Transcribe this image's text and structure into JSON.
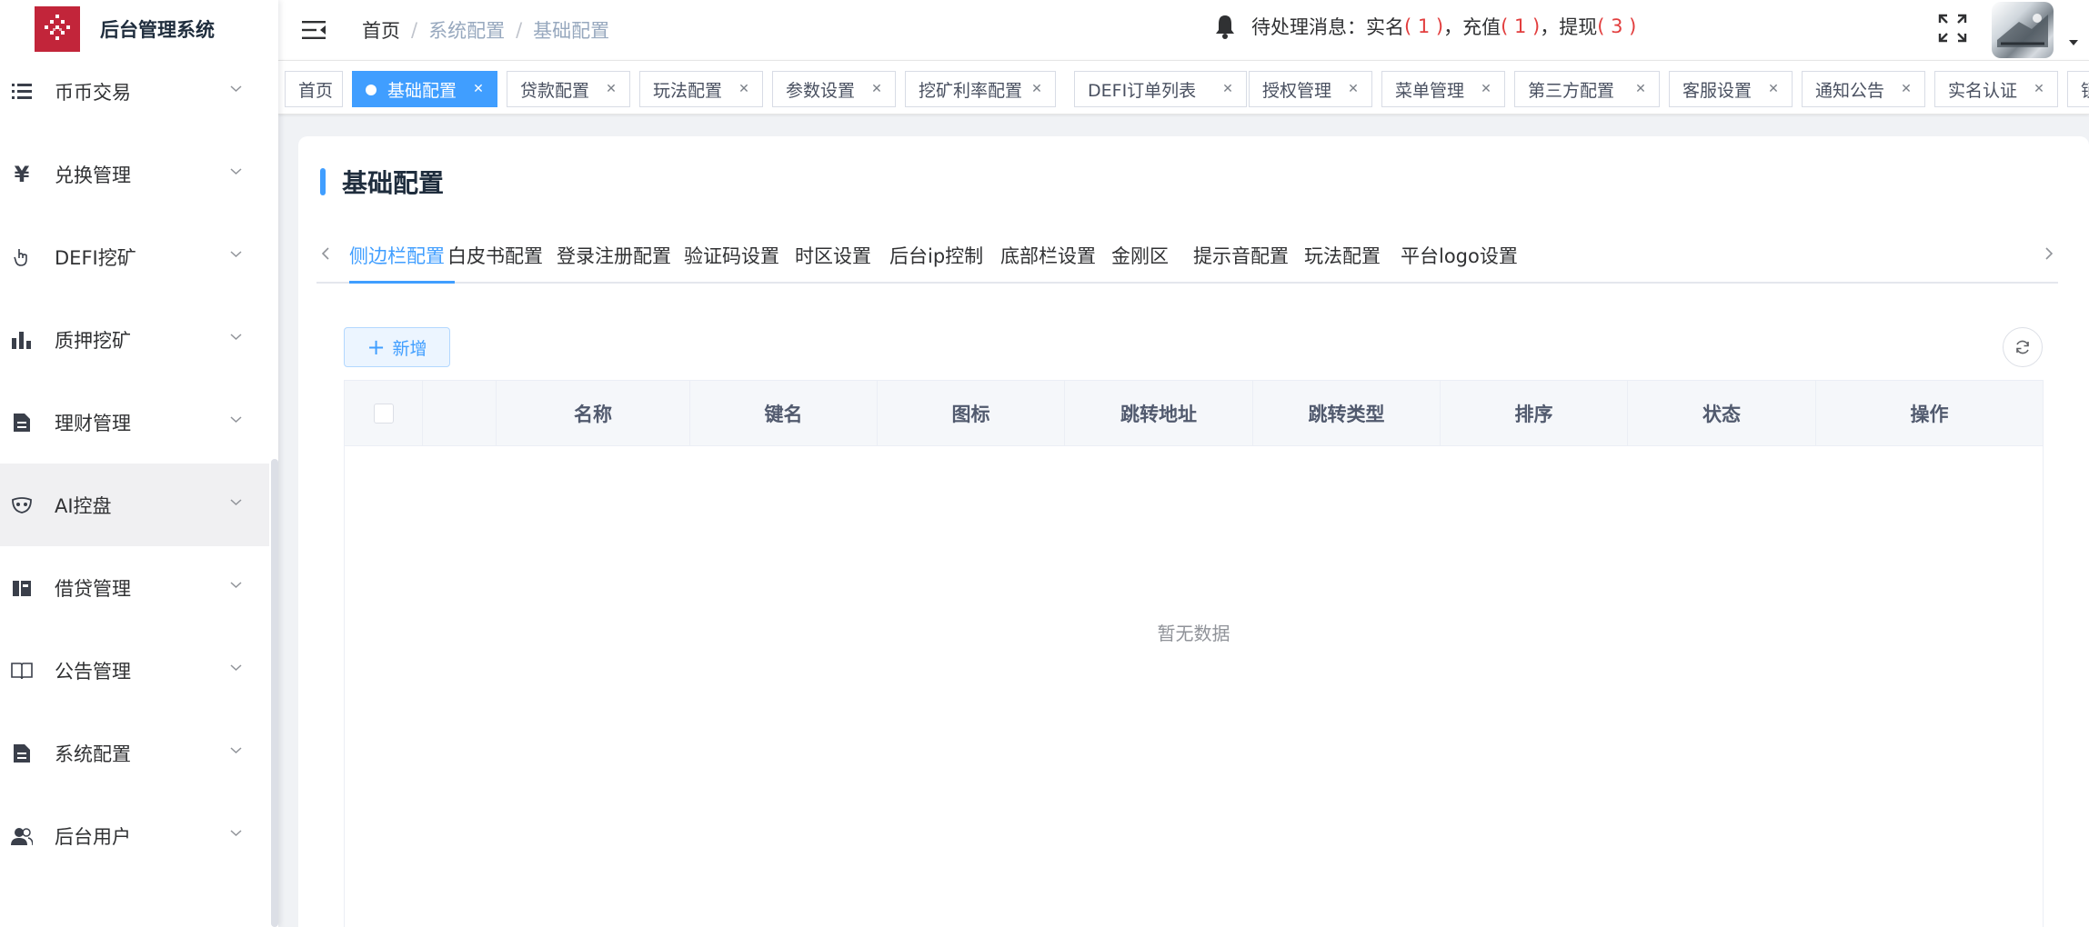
{
  "app": {
    "title": "后台管理系统"
  },
  "sidebar": {
    "items": [
      {
        "label": "币币交易",
        "icon": "list-icon"
      },
      {
        "label": "兑换管理",
        "icon": "yen-icon"
      },
      {
        "label": "DEFI挖矿",
        "icon": "hand-pointer-icon"
      },
      {
        "label": "质押挖矿",
        "icon": "bar-chart-icon"
      },
      {
        "label": "理财管理",
        "icon": "document-icon"
      },
      {
        "label": "AI控盘",
        "icon": "mask-icon",
        "active": true
      },
      {
        "label": "借贷管理",
        "icon": "wallet-icon"
      },
      {
        "label": "公告管理",
        "icon": "book-icon"
      },
      {
        "label": "系统配置",
        "icon": "document-icon"
      },
      {
        "label": "后台用户",
        "icon": "users-icon"
      }
    ]
  },
  "header": {
    "breadcrumb": [
      "首页",
      "系统配置",
      "基础配置"
    ],
    "notify": {
      "prefix": "待处理消息：实名",
      "realname_count": "( 1 )",
      "recharge_label": "，充值",
      "recharge_count": "( 1 )",
      "withdraw_label": "，提现",
      "withdraw_count": "( 3 )"
    }
  },
  "tags": [
    {
      "label": "首页",
      "closable": false
    },
    {
      "label": "基础配置",
      "closable": true,
      "active": true
    },
    {
      "label": "贷款配置",
      "closable": true
    },
    {
      "label": "玩法配置",
      "closable": true
    },
    {
      "label": "参数设置",
      "closable": true
    },
    {
      "label": "挖矿利率配置",
      "closable": true
    },
    {
      "label": "DEFI订单列表",
      "closable": true
    },
    {
      "label": "授权管理",
      "closable": true
    },
    {
      "label": "菜单管理",
      "closable": true
    },
    {
      "label": "第三方配置",
      "closable": true
    },
    {
      "label": "客服设置",
      "closable": true
    },
    {
      "label": "通知公告",
      "closable": true
    },
    {
      "label": "实名认证",
      "closable": true
    },
    {
      "label": "锁",
      "closable": false
    }
  ],
  "page": {
    "title": "基础配置",
    "subtabs": [
      "侧边栏配置",
      "白皮书配置",
      "登录注册配置",
      "验证码设置",
      "时区设置",
      "后台ip控制",
      "底部栏设置",
      "金刚区",
      "提示音配置",
      "玩法配置",
      "平台logo设置"
    ],
    "active_subtab": "侧边栏配置",
    "add_button": "新增",
    "table": {
      "columns": [
        "",
        "",
        "名称",
        "键名",
        "图标",
        "跳转地址",
        "跳转类型",
        "排序",
        "状态",
        "操作"
      ],
      "empty_text": "暂无数据"
    }
  },
  "colors": {
    "primary": "#409eff",
    "brand": "#c2253a",
    "alert": "#e23e3e"
  }
}
